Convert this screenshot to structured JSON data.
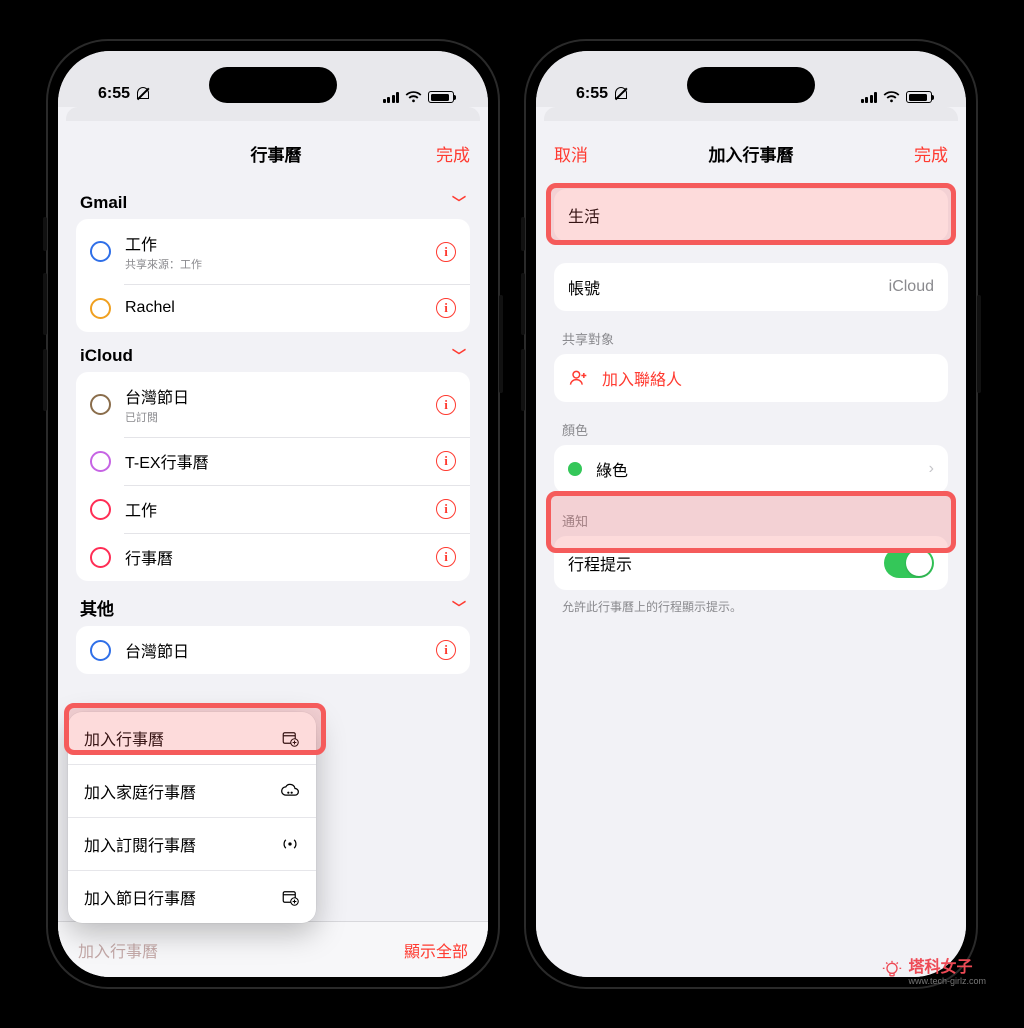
{
  "status": {
    "time": "6:55"
  },
  "left": {
    "title": "行事曆",
    "done": "完成",
    "sections": [
      {
        "name": "Gmail",
        "items": [
          {
            "label": "工作",
            "sub": "共享來源：工作",
            "ring": "#2f6fe8"
          },
          {
            "label": "Rachel",
            "ring": "#f0a020"
          }
        ]
      },
      {
        "name": "iCloud",
        "items": [
          {
            "label": "台灣節日",
            "sub": "已訂閱",
            "ring": "#8a6d4b"
          },
          {
            "label": "T-EX行事曆",
            "ring": "#c664e4"
          },
          {
            "label": "工作",
            "ring": "#ff2d55"
          },
          {
            "label": "行事曆",
            "ring": "#ff2d55"
          }
        ]
      },
      {
        "name": "其他",
        "items": [
          {
            "label": "台灣節日",
            "ring": "#2f6fe8"
          }
        ]
      }
    ],
    "popup": {
      "items": [
        {
          "label": "加入行事曆",
          "icon": "calendar-add"
        },
        {
          "label": "加入家庭行事曆",
          "icon": "cloud-people"
        },
        {
          "label": "加入訂閱行事曆",
          "icon": "broadcast"
        },
        {
          "label": "加入節日行事曆",
          "icon": "calendar-add"
        }
      ]
    },
    "toolbar": {
      "left": "加入行事曆",
      "right": "顯示全部"
    }
  },
  "right": {
    "cancel": "取消",
    "title": "加入行事曆",
    "done": "完成",
    "name_value": "生活",
    "account_label": "帳號",
    "account_value": "iCloud",
    "share_header": "共享對象",
    "add_contact": "加入聯絡人",
    "color_header": "顏色",
    "color_label": "綠色",
    "notify_header": "通知",
    "notify_label": "行程提示",
    "notify_footnote": "允許此行事曆上的行程顯示提示。"
  },
  "watermark": {
    "title": "塔科女子",
    "sub": "www.tech-girlz.com"
  }
}
